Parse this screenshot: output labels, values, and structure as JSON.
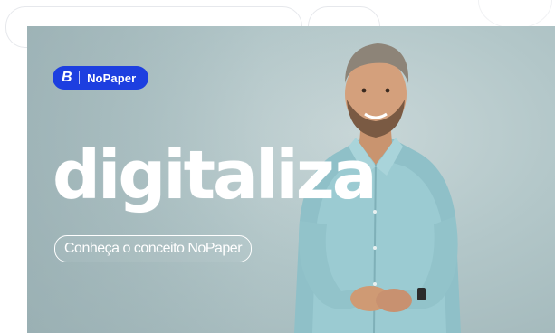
{
  "banner": {
    "badge": {
      "logo_letter": "B",
      "brand": "NoPaper",
      "color": "#1d3fe0"
    },
    "headline": "digitaliza",
    "cta_label": "Conheça o conceito NoPaper"
  }
}
